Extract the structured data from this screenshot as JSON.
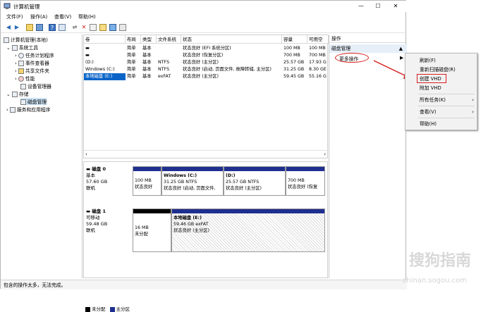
{
  "window": {
    "title": "计算机管理",
    "min": "—",
    "max": "☐",
    "close": "✕"
  },
  "menu": [
    "文件(F)",
    "操作(A)",
    "查看(V)",
    "帮助(H)"
  ],
  "tree": {
    "root": "计算机管理(本地)",
    "system_tools": "系统工具",
    "task_scheduler": "任务计划程序",
    "event_viewer": "事件查看器",
    "shared_folders": "共享文件夹",
    "performance": "性能",
    "device_manager": "设备管理器",
    "storage": "存储",
    "disk_mgmt": "磁盘管理",
    "services": "服务和应用程序"
  },
  "volume_table": {
    "headers": [
      "卷",
      "布局",
      "类型",
      "文件系统",
      "状态",
      "容量",
      "可用空"
    ],
    "rows": [
      [
        "",
        "简单",
        "基本",
        "",
        "状态良好 (EFI 系统分区)",
        "100 MB",
        "100 MB"
      ],
      [
        "",
        "简单",
        "基本",
        "",
        "状态良好 (恢复分区)",
        "700 MB",
        "700 MB"
      ],
      [
        "(D:)",
        "简单",
        "基本",
        "NTFS",
        "状态良好 (主分区)",
        "25.57 GB",
        "17.93 G"
      ],
      [
        "Windows (C:)",
        "简单",
        "基本",
        "NTFS",
        "状态良好 (启动, 页面文件, 故障转储, 主分区)",
        "31.25 GB",
        "8.30 GE"
      ],
      [
        "本地磁盘 (E:)",
        "简单",
        "基本",
        "exFAT",
        "状态良好 (主分区)",
        "59.45 GB",
        "55.16 G"
      ]
    ]
  },
  "disk0": {
    "name": "磁盘 0",
    "type": "基本",
    "size": "57.60 GB",
    "status": "联机",
    "parts": [
      {
        "l1": "100 MB",
        "l2": "状态良好"
      },
      {
        "title": "Windows (C:)",
        "l1": "31.25 GB NTFS",
        "l2": "状态良好 (启动, 页面文件,"
      },
      {
        "title": "(D:)",
        "l1": "25.57 GB NTFS",
        "l2": "状态良好 (主分区)"
      },
      {
        "l1": "700 MB",
        "l2": "状态良好 (恢复"
      }
    ]
  },
  "disk1": {
    "name": "磁盘 1",
    "type": "可移动",
    "size": "59.48 GB",
    "status": "联机",
    "parts": [
      {
        "l1": "16 MB",
        "l2": "未分配"
      },
      {
        "title": "本地磁盘 (E:)",
        "l1": "59.46 GB exFAT",
        "l2": "状态良好 (主分区)"
      }
    ]
  },
  "legend": {
    "unalloc": "未分配",
    "primary": "主分区"
  },
  "ops": {
    "header": "操作",
    "section": "磁盘管理",
    "more": "更多操作"
  },
  "context_menu": {
    "refresh": "刷新(F)",
    "rescan": "重新扫描磁盘(R)",
    "create_vhd": "创建 VHD",
    "attach_vhd": "附加 VHD",
    "all_tasks": "所有任务(K)",
    "view": "查看(V)",
    "help": "帮助(H)"
  },
  "status": "包含的操作太多，无法完成。",
  "watermark": {
    "big": "搜狗指南",
    "small": "zhinan.sogou.com"
  },
  "colors": {
    "primary_bar": "#1f2f8f",
    "highlight": "#d71f1f",
    "selected_row": "#0a64c8"
  }
}
